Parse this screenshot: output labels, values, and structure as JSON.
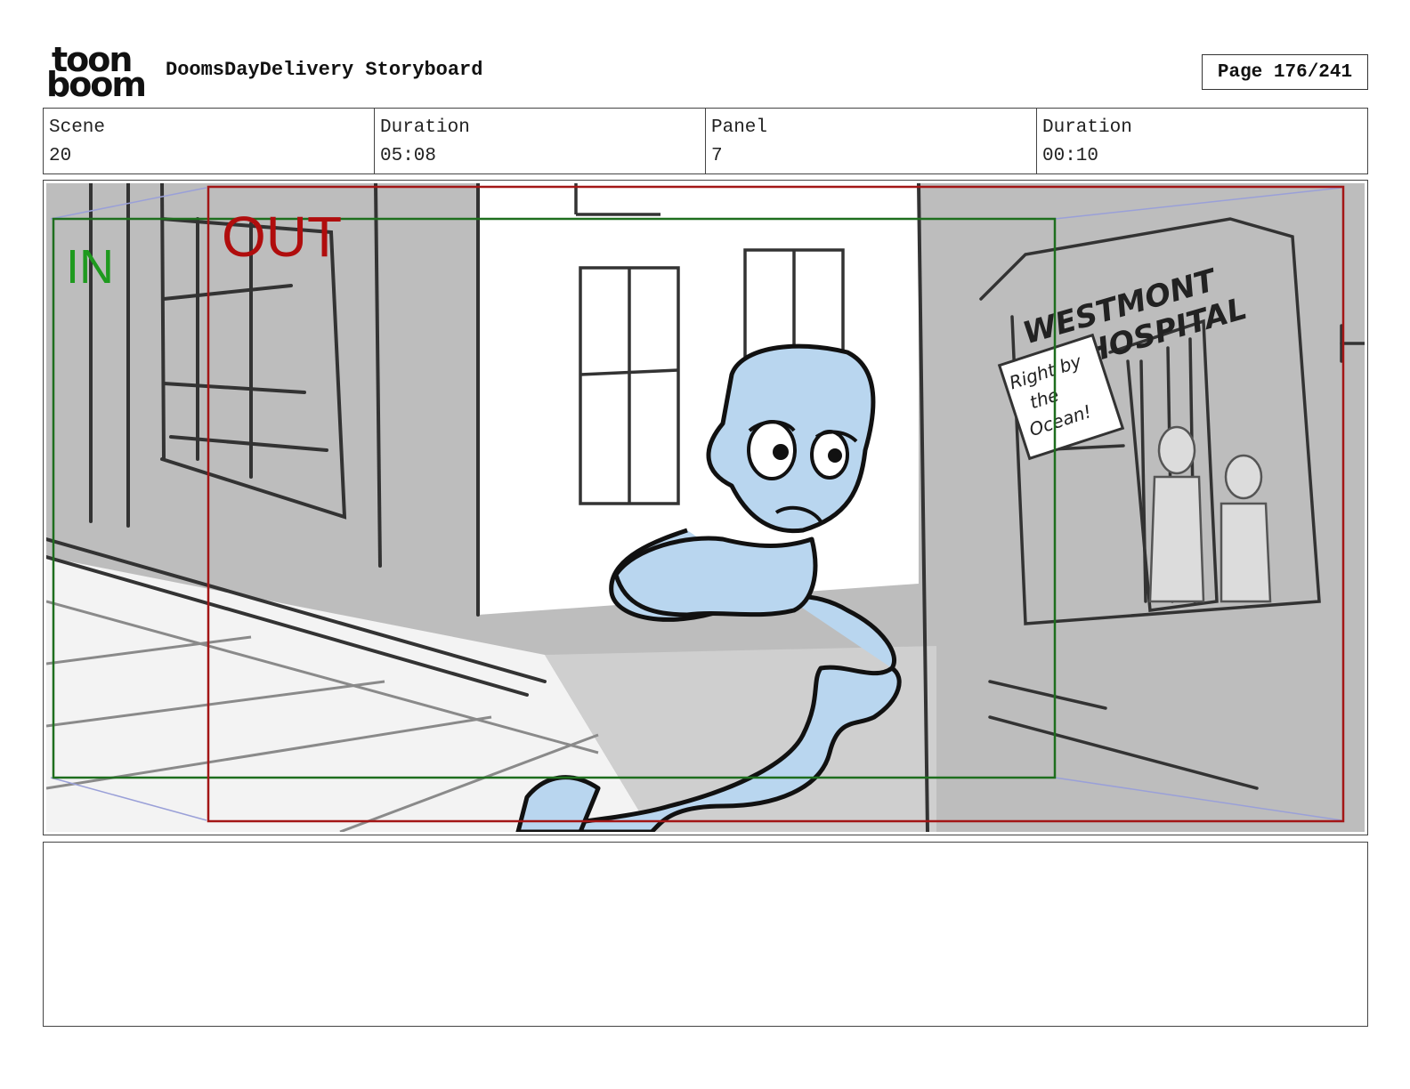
{
  "header": {
    "logo": {
      "line1": "toon",
      "line2": "boom"
    },
    "project_title": "DoomsDayDelivery Storyboard",
    "page_label": "Page 176/241"
  },
  "info": {
    "scene": {
      "label": "Scene",
      "value": "20"
    },
    "scene_duration": {
      "label": "Duration",
      "value": "05:08"
    },
    "panel": {
      "label": "Panel",
      "value": "7"
    },
    "panel_duration": {
      "label": "Duration",
      "value": "00:10"
    }
  },
  "panel": {
    "in_label": "IN",
    "out_label": "OUT",
    "sign_line1": "WESTMONT",
    "sign_line2": "HOSPITAL",
    "poster_line1": "Right by",
    "poster_line2": "the",
    "poster_line3": "Ocean!",
    "colors": {
      "in_frame": "#1e6e1e",
      "out_frame": "#a31616",
      "character_fill": "#b9d6ef",
      "background_gray": "#bdbdbd"
    }
  },
  "notes": {
    "text": ""
  }
}
